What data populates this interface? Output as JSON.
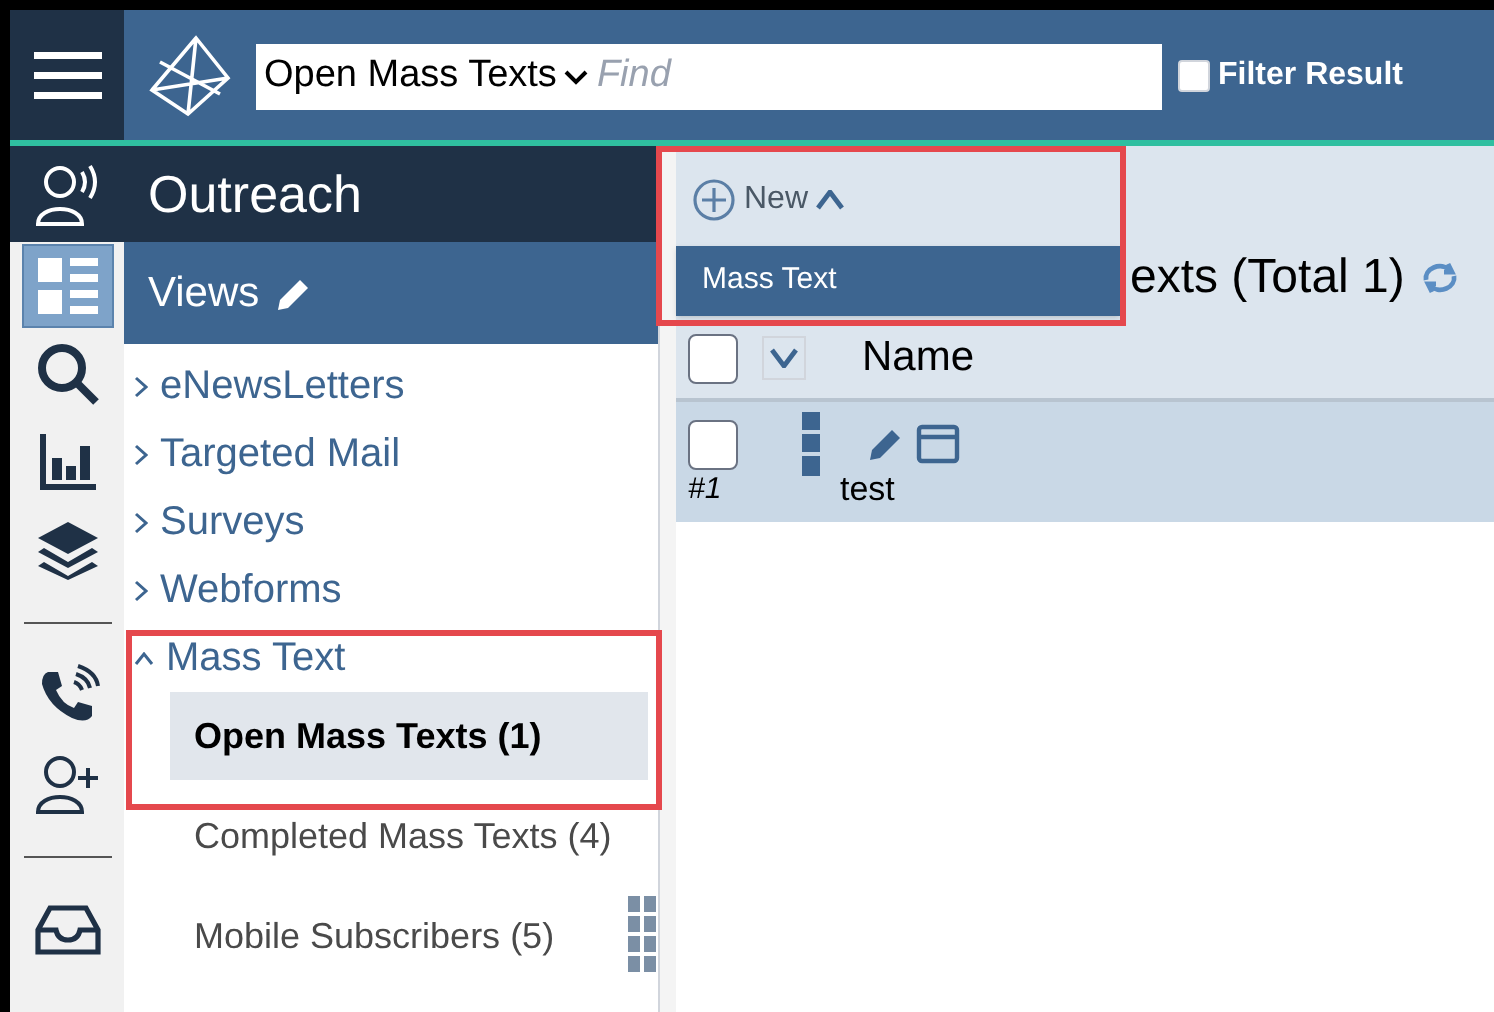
{
  "top_bar": {
    "view_selector": "Open Mass Texts",
    "search": {
      "placeholder": "Find"
    },
    "filter": {
      "label": "Filter Result",
      "checked": false
    }
  },
  "module": {
    "title": "Outreach"
  },
  "views": {
    "title": "Views"
  },
  "rail": [
    {
      "kind": "views",
      "selected": true
    },
    {
      "kind": "search",
      "selected": false
    },
    {
      "kind": "chart",
      "selected": false
    },
    {
      "kind": "layers",
      "selected": false
    },
    {
      "kind": "divider"
    },
    {
      "kind": "phone",
      "selected": false
    },
    {
      "kind": "person-add",
      "selected": false
    },
    {
      "kind": "divider"
    },
    {
      "kind": "inbox",
      "selected": false
    }
  ],
  "nav": [
    {
      "label": "eNewsLetters",
      "expanded": false
    },
    {
      "label": "Targeted Mail",
      "expanded": false
    },
    {
      "label": "Surveys",
      "expanded": false
    },
    {
      "label": "Webforms",
      "expanded": false
    },
    {
      "label": "Mass Text",
      "expanded": true,
      "children": [
        {
          "label": "Open Mass Texts (1)",
          "selected": true
        },
        {
          "label": "Completed Mass Texts (4)",
          "selected": false
        },
        {
          "label": "Mobile Subscribers (5)",
          "selected": false
        }
      ]
    }
  ],
  "toolbar": {
    "new_button": "New",
    "menu_open": true,
    "menu": [
      {
        "label": "Mass Text"
      }
    ]
  },
  "heading": "exts (Total 1)",
  "table": {
    "all_checked": false,
    "columns": [
      "Name"
    ],
    "rows": [
      {
        "number": "#1",
        "name": "test",
        "checked": false
      }
    ]
  }
}
